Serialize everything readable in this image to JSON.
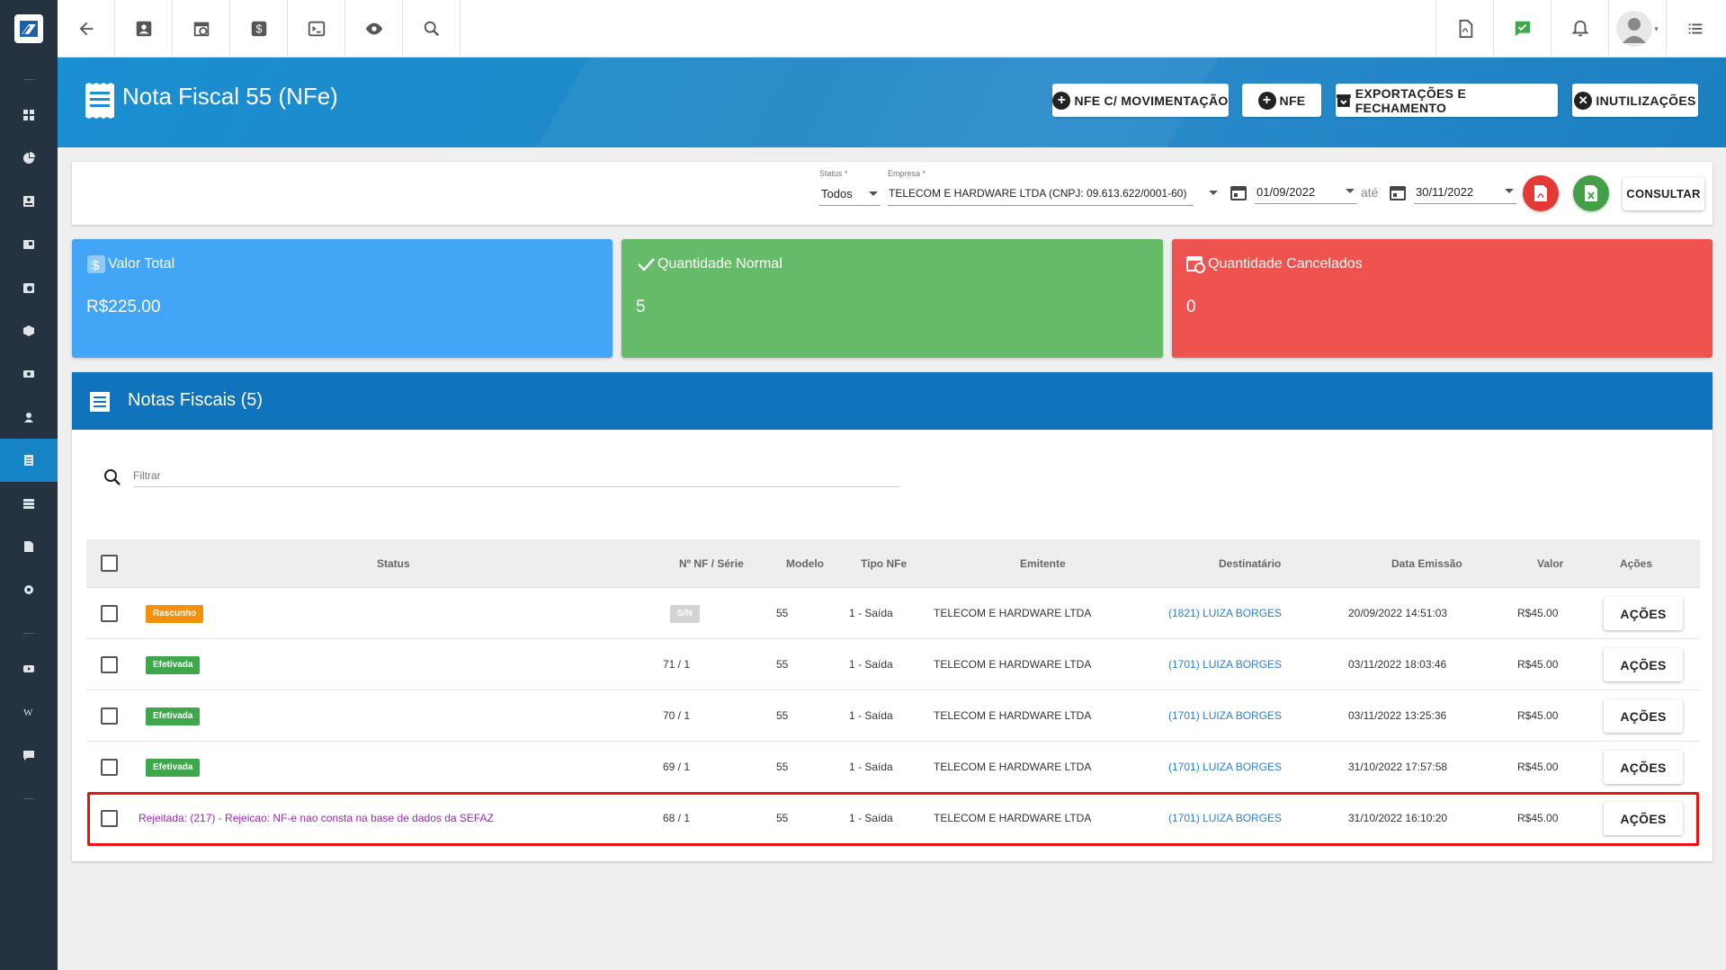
{
  "sidebar": {
    "items": [
      {
        "icon": "dashboard-icon"
      },
      {
        "icon": "pie-chart-icon"
      },
      {
        "icon": "contact-card-icon"
      },
      {
        "icon": "book-icon"
      },
      {
        "icon": "calendar-clock-icon"
      },
      {
        "icon": "box-icon"
      },
      {
        "icon": "money-icon"
      },
      {
        "icon": "person-pin-icon"
      },
      {
        "icon": "receipt-icon",
        "active": true
      },
      {
        "icon": "server-icon"
      },
      {
        "icon": "document-icon"
      },
      {
        "icon": "gear-icon"
      },
      {
        "icon": "video-icon"
      },
      {
        "icon": "wordpress-icon"
      },
      {
        "icon": "chat-icon"
      }
    ]
  },
  "topbar": {
    "left_buttons": [
      "back-arrow-icon",
      "contact-icon",
      "calendar-clock-icon",
      "dollar-icon",
      "terminal-icon",
      "eye-icon",
      "search-icon"
    ],
    "right_buttons": [
      "pdf-icon",
      "chat-check-icon",
      "bell-icon",
      "avatar",
      "menu-list-icon"
    ]
  },
  "header": {
    "title": "Nota Fiscal 55 (NFe)",
    "buttons": {
      "nfe_mov": "NFE C/ MOVIMENTAÇÃO",
      "nfe": "NFE",
      "export": "EXPORTAÇÕES E FECHAMENTO",
      "inutil": "INUTILIZAÇÕES"
    }
  },
  "filters": {
    "status_label": "Status *",
    "status_value": "Todos",
    "empresa_label": "Empresa *",
    "empresa_value": "TELECOM E HARDWARE LTDA (CNPJ: 09.613.622/0001-60)",
    "date_from": "01/09/2022",
    "ate": "até",
    "date_to": "30/11/2022",
    "consultar": "CONSULTAR"
  },
  "stats": {
    "valor_total_title": "Valor Total",
    "valor_total_value": "R$225.00",
    "qtd_normal_title": "Quantidade Normal",
    "qtd_normal_value": "5",
    "qtd_cancel_title": "Quantidade Cancelados",
    "qtd_cancel_value": "0",
    "colors": {
      "blue": "#42a5f5",
      "green": "#66bb6a",
      "red": "#ef5350"
    }
  },
  "table": {
    "title": "Notas Fiscais (5)",
    "filter_placeholder": "Filtrar",
    "headers": {
      "status": "Status",
      "nf": "Nº NF / Série",
      "modelo": "Modelo",
      "tipo": "Tipo NFe",
      "emitente": "Emitente",
      "destinatario": "Destinatário",
      "data": "Data Emissão",
      "valor": "Valor",
      "acoes": "Ações"
    },
    "rows": [
      {
        "status": "Rascunho",
        "nf": "S/N",
        "modelo": "55",
        "tipo": "1 - Saída",
        "emitente": "TELECOM E HARDWARE LTDA",
        "destinatario": "(1821) LUIZA BORGES",
        "data": "20/09/2022 14:51:03",
        "valor": "R$45.00",
        "acoes": "AÇÕES"
      },
      {
        "status": "Efetivada",
        "nf": "71 / 1",
        "modelo": "55",
        "tipo": "1 - Saída",
        "emitente": "TELECOM E HARDWARE LTDA",
        "destinatario": "(1701) LUIZA BORGES",
        "data": "03/11/2022 18:03:46",
        "valor": "R$45.00",
        "acoes": "AÇÕES"
      },
      {
        "status": "Efetivada",
        "nf": "70 / 1",
        "modelo": "55",
        "tipo": "1 - Saída",
        "emitente": "TELECOM E HARDWARE LTDA",
        "destinatario": "(1701) LUIZA BORGES",
        "data": "03/11/2022 13:25:36",
        "valor": "R$45.00",
        "acoes": "AÇÕES"
      },
      {
        "status": "Efetivada",
        "nf": "69 / 1",
        "modelo": "55",
        "tipo": "1 - Saída",
        "emitente": "TELECOM E HARDWARE LTDA",
        "destinatario": "(1701) LUIZA BORGES",
        "data": "31/10/2022 17:57:58",
        "valor": "R$45.00",
        "acoes": "AÇÕES"
      },
      {
        "status": "Rejeitada: (217) - Rejeicao: NF-e nao consta na base de dados da SEFAZ",
        "nf": "68 / 1",
        "modelo": "55",
        "tipo": "1 - Saída",
        "emitente": "TELECOM E HARDWARE LTDA",
        "destinatario": "(1701) LUIZA BORGES",
        "data": "31/10/2022 16:10:20",
        "valor": "R$45.00",
        "acoes": "AÇÕES"
      }
    ]
  }
}
